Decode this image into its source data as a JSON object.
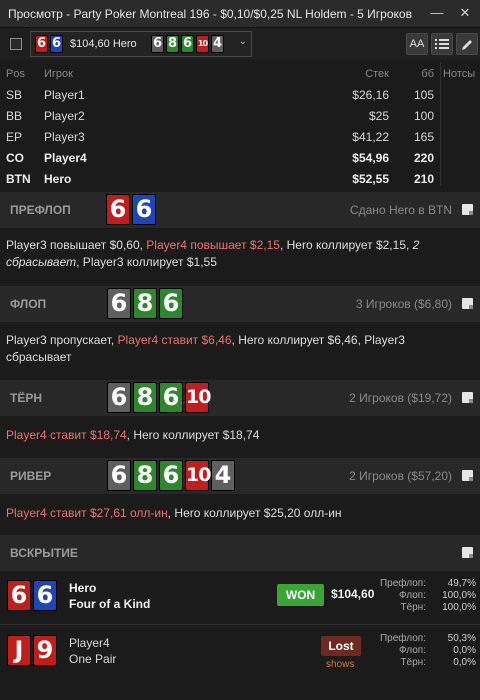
{
  "window": {
    "title": "Просмотр - Party Poker Montreal 196 - $0,10/$0,25 NL Holdem - 5 Игроков",
    "minimize": "—",
    "close": "✕"
  },
  "toolbar": {
    "hand_amount": "$104,60 Hero",
    "hand_cards": [
      {
        "rank": "6",
        "suit": "h"
      },
      {
        "rank": "6",
        "suit": "d"
      }
    ],
    "board_cards": [
      {
        "rank": "6",
        "suit": "s"
      },
      {
        "rank": "8",
        "suit": "c"
      },
      {
        "rank": "6",
        "suit": "c"
      },
      {
        "rank": "10",
        "suit": "h"
      },
      {
        "rank": "4",
        "suit": "s"
      }
    ],
    "font_btn": "AA",
    "list_btn": "list-icon",
    "edit_btn": "pencil-icon"
  },
  "players_table": {
    "headers": {
      "pos": "Pos",
      "player": "Игрок",
      "stack": "Стек",
      "bb": "бб",
      "notes": "Нотсы"
    },
    "rows": [
      {
        "pos": "SB",
        "name": "Player1",
        "stack": "$26,16",
        "bb": "105",
        "bold": false
      },
      {
        "pos": "BB",
        "name": "Player2",
        "stack": "$25",
        "bb": "100",
        "bold": false
      },
      {
        "pos": "EP",
        "name": "Player3",
        "stack": "$41,22",
        "bb": "165",
        "bold": false
      },
      {
        "pos": "CO",
        "name": "Player4",
        "stack": "$54,96",
        "bb": "220",
        "bold": true
      },
      {
        "pos": "BTN",
        "name": "Hero",
        "stack": "$52,55",
        "bb": "210",
        "bold": true
      }
    ]
  },
  "streets": {
    "preflop": {
      "name": "ПРЕФЛОП",
      "info": "Сдано Hero в BTN",
      "cards": [
        {
          "rank": "6",
          "suit": "h"
        },
        {
          "rank": "6",
          "suit": "d"
        }
      ],
      "actions": {
        "a1": "Player3 повышает $0,60, ",
        "a2": "Player4 повышает $2,15",
        "a3": ", Hero коллирует $2,15, ",
        "a4": "2 сбрасывает",
        "a5": ", Player3 коллирует $1,55"
      }
    },
    "flop": {
      "name": "ФЛОП",
      "info": "3 Игроков ($6,80)",
      "cards": [
        {
          "rank": "6",
          "suit": "s"
        },
        {
          "rank": "8",
          "suit": "c"
        },
        {
          "rank": "6",
          "suit": "c"
        }
      ],
      "actions": {
        "a1": "Player3 пропускает, ",
        "a2": "Player4 ставит $6,46",
        "a3": ", Hero коллирует $6,46, Player3 сбрасывает"
      }
    },
    "turn": {
      "name": "ТЁРН",
      "info": "2 Игроков ($19,72)",
      "cards": [
        {
          "rank": "6",
          "suit": "s"
        },
        {
          "rank": "8",
          "suit": "c"
        },
        {
          "rank": "6",
          "suit": "c"
        },
        {
          "rank": "10",
          "suit": "h"
        }
      ],
      "actions": {
        "a1": "Player4 ставит $18,74",
        "a2": ", Hero коллирует $18,74"
      }
    },
    "river": {
      "name": "РИВЕР",
      "info": "2 Игроков ($57,20)",
      "cards": [
        {
          "rank": "6",
          "suit": "s"
        },
        {
          "rank": "8",
          "suit": "c"
        },
        {
          "rank": "6",
          "suit": "c"
        },
        {
          "rank": "10",
          "suit": "h"
        },
        {
          "rank": "4",
          "suit": "s"
        }
      ],
      "actions": {
        "a1": "Player4 ставит $27,61 олл-ин",
        "a2": ", Hero коллирует $25,20 олл-ин"
      }
    }
  },
  "showdown": {
    "name": "ВСКРЫТИЕ",
    "equity_labels": {
      "preflop": "Префлоп:",
      "flop": "Флоп:",
      "turn": "Тёрн:"
    },
    "players": [
      {
        "name": "Hero",
        "hand": "Four of a Kind",
        "cards": [
          {
            "rank": "6",
            "suit": "h"
          },
          {
            "rank": "6",
            "suit": "d"
          }
        ],
        "result": "WON",
        "amount": "$104,60",
        "equity": {
          "preflop": "49,7%",
          "flop": "100,0%",
          "turn": "100,0%"
        }
      },
      {
        "name": "Player4",
        "hand": "One Pair",
        "cards": [
          {
            "rank": "J",
            "suit": "h"
          },
          {
            "rank": "9",
            "suit": "h"
          }
        ],
        "result": "Lost",
        "shows": "shows",
        "equity": {
          "preflop": "50,3%",
          "flop": "0,0%",
          "turn": "0,0%"
        }
      }
    ]
  },
  "colors": {
    "hearts": "#c21d1d",
    "diamonds": "#1e46b8",
    "clubs": "#2a8a2a",
    "spades": "#5f5f5f",
    "aggressive_action": "#f07070",
    "won": "#3aa534",
    "lost": "#6e2a22"
  }
}
